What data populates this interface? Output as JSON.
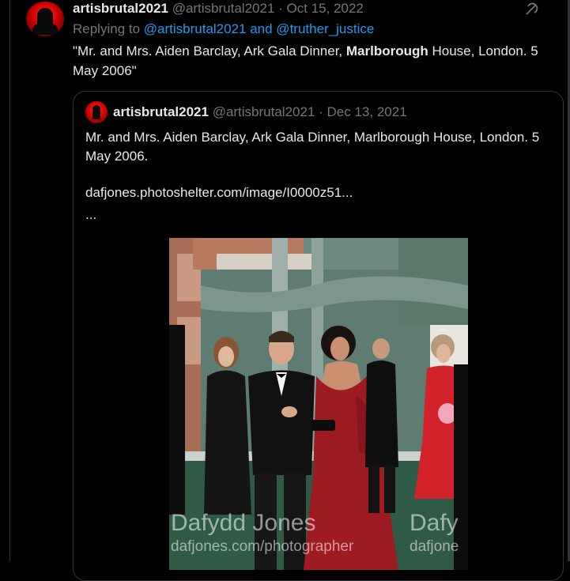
{
  "reply": {
    "author_name": "artisbrutal2021",
    "author_handle": "@artisbrutal2021",
    "separator": " · ",
    "date": "Oct 15, 2022",
    "replying_prefix": "Replying to ",
    "replying_to": "@artisbrutal2021 and @truther_justice",
    "text_before": "\"Mr. and Mrs. Aiden Barclay, Ark Gala Dinner, ",
    "text_bold": "Marlborough",
    "text_after": " House, London. 5 May 2006\""
  },
  "quote": {
    "author_name": "artisbrutal2021",
    "author_handle": "@artisbrutal2021",
    "separator": " · ",
    "date": "Dec 13, 2021",
    "text": "Mr. and Mrs. Aiden Barclay, Ark Gala Dinner, Marlborough House, London. 5 May 2006.",
    "link": "dafjones.photoshelter.com/image/I0000z51...",
    "ellipsis": "...",
    "photo": {
      "watermark_name": "Dafydd Jones",
      "watermark_site": "dafjones.com/photographer",
      "watermark_name_right": "Dafy",
      "watermark_site_right": "dafjone"
    }
  },
  "icons": {
    "more": "share-icon",
    "avatar": "profile-avatar"
  }
}
